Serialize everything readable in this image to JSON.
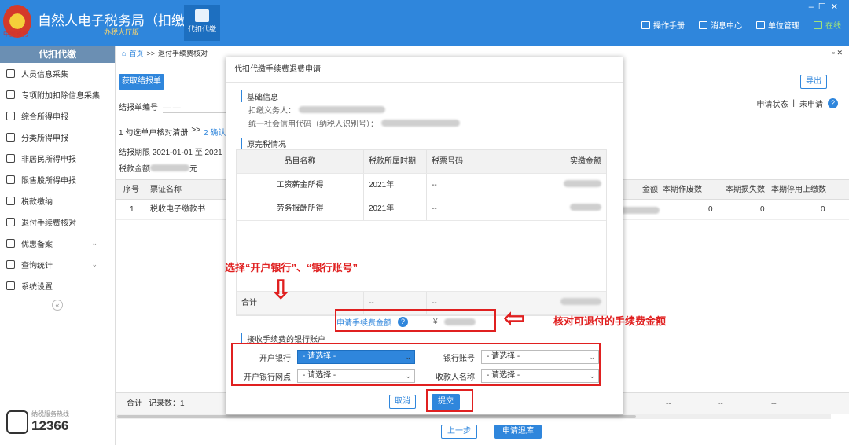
{
  "app": {
    "title": "自然人电子税务局（扣缴端）",
    "subtitle": "办税大厅版",
    "module_label": "代扣代缴",
    "emblem_text": "中国税务"
  },
  "toplinks": {
    "manual": "操作手册",
    "messages": "消息中心",
    "unit": "单位管理",
    "online": "在线"
  },
  "sidebar": {
    "header": "代扣代缴",
    "items": [
      {
        "label": "人员信息采集",
        "icon": "person-icon"
      },
      {
        "label": "专项附加扣除信息采集",
        "icon": "list-icon"
      },
      {
        "label": "综合所得申报",
        "icon": "layers-icon"
      },
      {
        "label": "分类所得申报",
        "icon": "clock-icon"
      },
      {
        "label": "非居民所得申报",
        "icon": "person-outline-icon"
      },
      {
        "label": "限售股所得申报",
        "icon": "bar-icon"
      },
      {
        "label": "税款缴纳",
        "icon": "card-icon"
      },
      {
        "label": "退付手续费核对",
        "icon": "doc-icon"
      },
      {
        "label": "优惠备案",
        "icon": "file-icon",
        "chev": "⌄"
      },
      {
        "label": "查询统计",
        "icon": "search-list-icon",
        "chev": "⌄"
      },
      {
        "label": "系统设置",
        "icon": "gear-icon"
      }
    ],
    "collapse": "«",
    "hotline_label": "纳税服务热线",
    "hotline": "12366"
  },
  "breadcrumb": {
    "home": "首页",
    "sep": ">>",
    "current": "退付手续费核对"
  },
  "main": {
    "get_bill": "获取结报单",
    "export": "导出",
    "bill_no_label": "结报单编号",
    "bill_no_value": "— —",
    "status_label": "申请状态",
    "status_sep": "|",
    "status_value": "未申请",
    "step1": "1 勾选单户核对清册",
    "step_sep": ">>",
    "step2": "2 确认",
    "period_label": "结报期限",
    "period_from": "2021-01-01",
    "period_to_sep": "至",
    "period_to": "2021",
    "tax_label": "税款金额",
    "tax_unit": "元",
    "columns": {
      "no": "序号",
      "name": "票证名称",
      "amount": "金额",
      "void": "本期作废数",
      "loss": "本期损失数",
      "stop": "本期停用上缴数"
    },
    "row": {
      "no": "1",
      "name": "税收电子缴款书",
      "void": "0",
      "loss": "0",
      "stop": "0"
    },
    "footer_total": "合计",
    "footer_count": "记录数：1",
    "footer_dash": "--",
    "prev": "上一步",
    "apply_refund": "申请退库"
  },
  "modal": {
    "title": "代扣代缴手续费退费申请",
    "basic_title": "基础信息",
    "agent_label": "扣缴义务人：",
    "credit_label": "统一社会信用代码（纳税人识别号）：",
    "tax_title": "原完税情况",
    "columns": [
      "品目名称",
      "税款所属时期",
      "税票号码",
      "实缴金额"
    ],
    "rows": [
      {
        "item": "工资薪金所得",
        "period": "2021年",
        "ticket": "--"
      },
      {
        "item": "劳务报酬所得",
        "period": "2021年",
        "ticket": "--"
      }
    ],
    "total_label": "合计",
    "total_dash": "--",
    "apply_amount_label": "申请手续费金额",
    "apply_amount_prefix": "¥",
    "bank_title": "接收手续费的银行账户",
    "bank_label": "开户银行",
    "account_label": "银行账号",
    "branch_label": "开户银行网点",
    "payee_label": "收款人名称",
    "placeholder": "- 请选择 -",
    "cancel": "取消",
    "submit": "提交"
  },
  "annotations": {
    "left": "选择“开户银行”、“银行账号”",
    "right": "核对可退付的手续费金额",
    "arrow_down": "⇩",
    "arrow_left": "⇦"
  }
}
